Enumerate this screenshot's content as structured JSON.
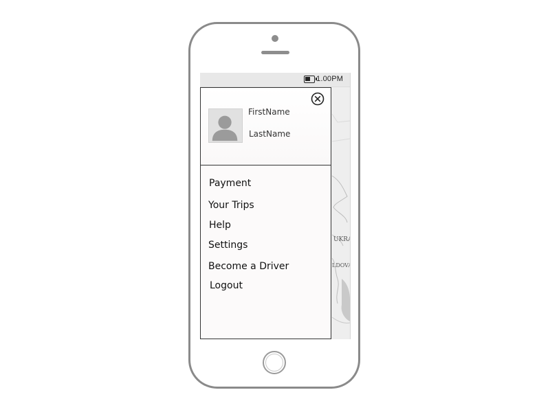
{
  "status_bar": {
    "time": "1.00PM",
    "battery_icon": "battery-icon"
  },
  "map": {
    "labels": [
      "UKRA",
      "LDOVA"
    ]
  },
  "drawer": {
    "close_icon": "close-icon",
    "profile": {
      "avatar_icon": "person-icon",
      "first_name": "FirstName",
      "last_name": "LastName"
    },
    "menu": [
      {
        "label": "Payment"
      },
      {
        "label": "Your Trips"
      },
      {
        "label": "Help"
      },
      {
        "label": "Settings"
      },
      {
        "label": "Become a Driver"
      },
      {
        "label": "Logout"
      }
    ]
  },
  "colors": {
    "phone_frame": "#8a8a8a",
    "drawer_background": "#fcfafa",
    "map_background": "#eeeeee",
    "text": "#111111"
  }
}
